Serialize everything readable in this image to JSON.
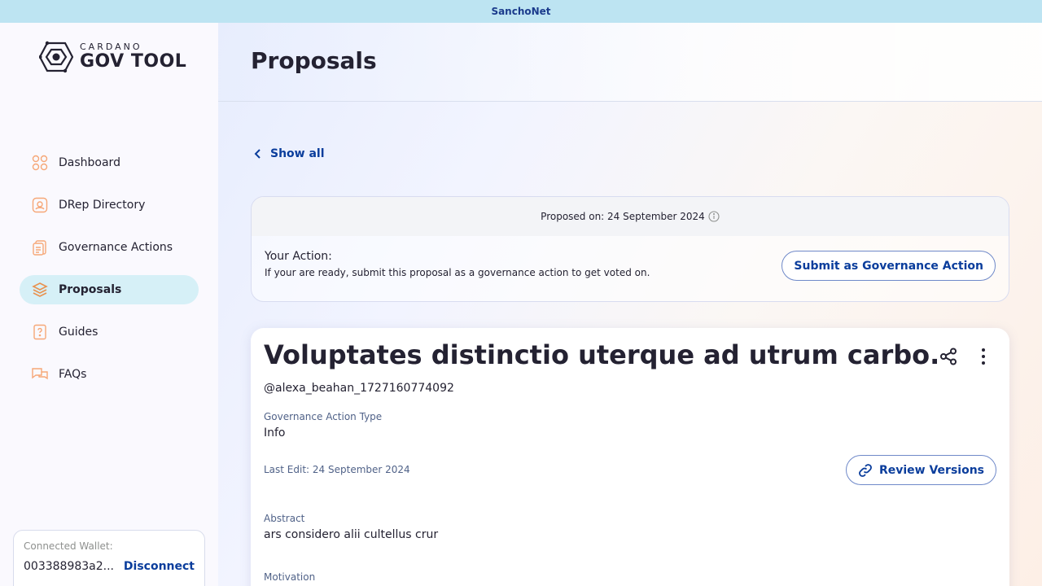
{
  "network_banner": "SanchoNet",
  "logo": {
    "small": "CARDANO",
    "big": "GOV TOOL"
  },
  "sidebar": {
    "items": [
      {
        "label": "Dashboard",
        "icon": "dashboard-icon"
      },
      {
        "label": "DRep Directory",
        "icon": "drep-directory-icon"
      },
      {
        "label": "Governance Actions",
        "icon": "governance-actions-icon"
      },
      {
        "label": "Proposals",
        "icon": "proposals-icon",
        "active": true
      },
      {
        "label": "Guides",
        "icon": "guides-icon"
      },
      {
        "label": "FAQs",
        "icon": "faqs-icon"
      }
    ]
  },
  "wallet": {
    "label": "Connected Wallet:",
    "address": "003388983a2...",
    "disconnect_label": "Disconnect"
  },
  "header": {
    "title": "Proposals"
  },
  "show_all_label": "Show all",
  "action_card": {
    "proposed_on": "Proposed on: 24 September 2024",
    "your_action_title": "Your Action:",
    "your_action_desc": "If your are ready, submit this proposal as a governance action to get voted on.",
    "submit_label": "Submit as Governance Action"
  },
  "proposal": {
    "title": "Voluptates distinctio uterque ad utrum carbo.",
    "author": "@alexa_beahan_1727160774092",
    "type_label": "Governance Action Type",
    "type_value": "Info",
    "last_edit": "Last Edit: 24 September 2024",
    "review_label": "Review Versions",
    "abstract_label": "Abstract",
    "abstract_value": "ars considero alii cultellus crur",
    "motivation_label": "Motivation"
  },
  "colors": {
    "accent": "#0a3d9c",
    "banner": "#bde4f2",
    "active_nav": "#d6f0f7",
    "icon_orange": "#f6a777"
  }
}
